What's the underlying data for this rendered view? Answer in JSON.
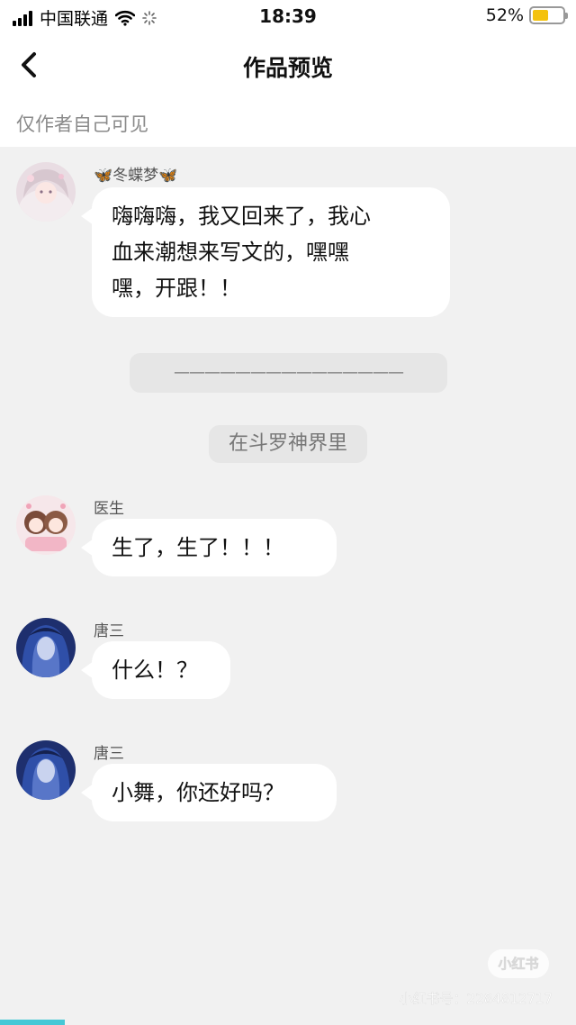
{
  "status_bar": {
    "carrier": "中国联通",
    "time": "18:39",
    "battery": "52%",
    "battery_level": 0.52,
    "battery_color": "#f4c20d"
  },
  "header": {
    "title": "作品预览",
    "back_icon": "chevron-left-icon",
    "visibility_note": "仅作者自己可见"
  },
  "messages": [
    {
      "sender": "🦋冬蝶梦🦋",
      "text_lines": [
        "嗨嗨嗨，我又回来了，我心",
        "血来潮想来写文的，嘿嘿",
        "嘿，开跟！！"
      ]
    },
    {
      "sender": "医生",
      "text_lines": [
        "生了，生了！！！"
      ]
    },
    {
      "sender": "唐三",
      "text_lines": [
        "什么！？"
      ]
    },
    {
      "sender": "唐三",
      "text_lines": [
        "小舞，你还好吗？"
      ]
    }
  ],
  "system_notes": {
    "divider": "———————————————",
    "scene": "在斗罗神界里"
  },
  "watermark": {
    "logo": "小红书",
    "id": "小红书号：2284812717"
  },
  "colors": {
    "chat_background": "#f1f1f1",
    "bubble": "#ffffff",
    "accent": "#45c8d6"
  }
}
